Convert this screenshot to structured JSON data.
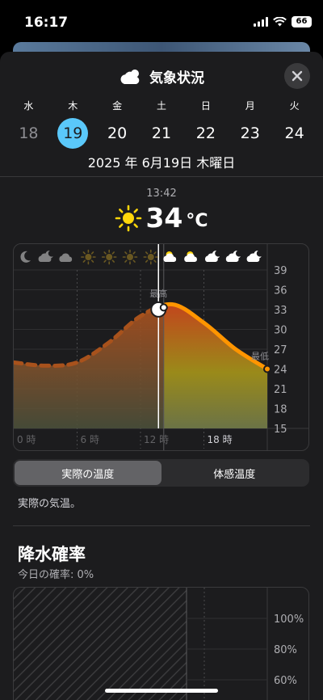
{
  "status": {
    "time": "16:17",
    "battery": "66"
  },
  "sheet": {
    "title": "気象状況",
    "close_icon": "xmark-icon"
  },
  "week": {
    "days": [
      {
        "weekday": "水",
        "date": "18",
        "state": "past"
      },
      {
        "weekday": "木",
        "date": "19",
        "state": "selected"
      },
      {
        "weekday": "金",
        "date": "20",
        "state": "future"
      },
      {
        "weekday": "土",
        "date": "21",
        "state": "future"
      },
      {
        "weekday": "日",
        "date": "22",
        "state": "future"
      },
      {
        "weekday": "月",
        "date": "23",
        "state": "future"
      },
      {
        "weekday": "火",
        "date": "24",
        "state": "future"
      }
    ],
    "full_date": "2025 年 6月19日 木曜日"
  },
  "current": {
    "time": "13:42",
    "temp": "34",
    "unit": "°C",
    "icon": "sun-icon"
  },
  "chart_data": {
    "type": "area",
    "x": [
      0,
      3,
      6,
      9,
      12,
      15,
      18,
      21,
      24
    ],
    "series": [
      {
        "values": [
          25,
          24.5,
          25,
          28,
          32,
          33.8,
          31,
          27,
          24
        ]
      }
    ],
    "current_x": 13.7,
    "forecast_start_x": 14.2,
    "ylim": [
      15,
      39
    ],
    "yticks": [
      "39",
      "36",
      "33",
      "30",
      "27",
      "24",
      "21",
      "18",
      "15"
    ],
    "xticks": [
      "0 時",
      "6 時",
      "12 時",
      "18 時"
    ],
    "annotations": {
      "max": "最高",
      "min": "最低"
    },
    "condition_icons": [
      "moon-icon",
      "cloud-moon-icon",
      "cloud-icon",
      "sun-icon",
      "sun-icon",
      "sun-icon",
      "sun-icon",
      "cloud-sun-icon",
      "cloud-sun-icon",
      "cloud-moon-icon",
      "cloud-moon-icon",
      "cloud-moon-icon"
    ]
  },
  "segmented": {
    "actual": "実際の温度",
    "feels": "体感温度"
  },
  "description": "実際の気温。",
  "precip": {
    "title": "降水確率",
    "subtitle": "今日の確率: 0%",
    "yticks": [
      "100%",
      "80%",
      "60%"
    ]
  },
  "colors": {
    "accent": "#5ac8fa",
    "line_orange": "#ff9500",
    "sheet_bg": "#1c1c1e"
  }
}
